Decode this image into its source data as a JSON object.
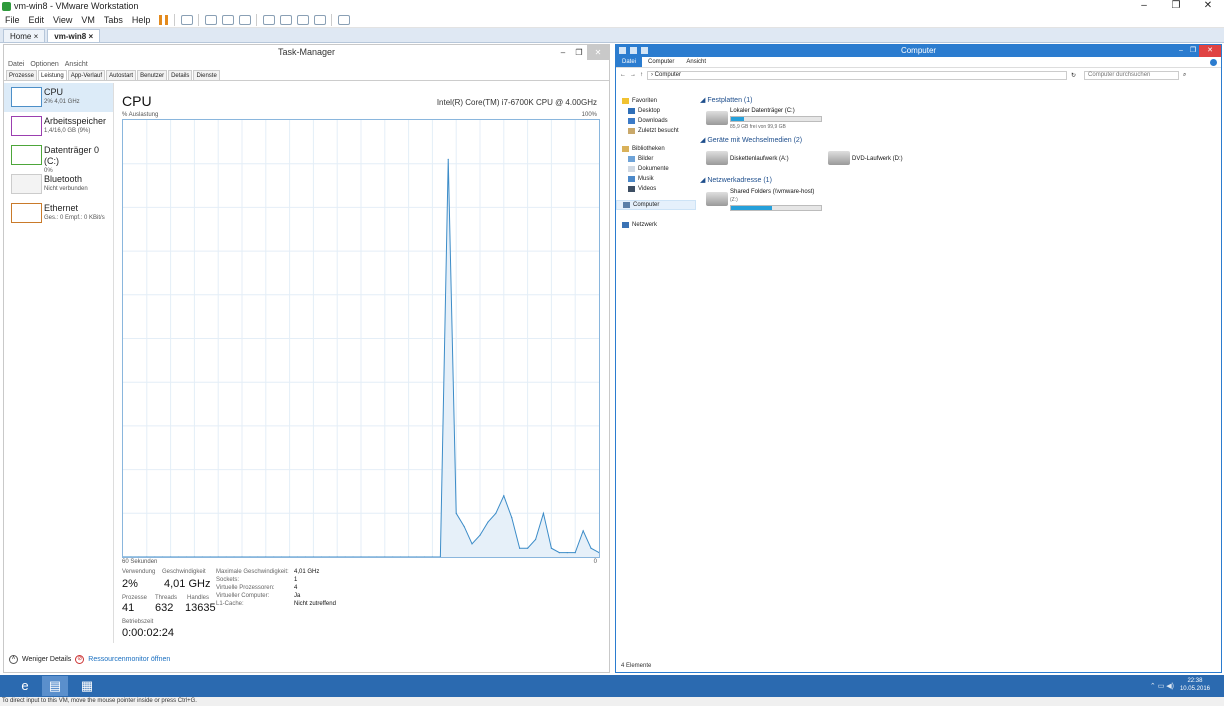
{
  "host": {
    "title": "vm-win8 - VMware Workstation",
    "window_controls": [
      "–",
      "❐",
      "✕"
    ],
    "menu": [
      "File",
      "Edit",
      "View",
      "VM",
      "Tabs",
      "Help"
    ],
    "tabs": [
      {
        "label": "Home"
      },
      {
        "label": "vm-win8"
      }
    ],
    "status": "To direct input to this VM, move the mouse pointer inside or press Ctrl+G."
  },
  "taskmgr": {
    "title": "Task-Manager",
    "menu": [
      "Datei",
      "Optionen",
      "Ansicht"
    ],
    "tabs": [
      "Prozesse",
      "Leistung",
      "App-Verlauf",
      "Autostart",
      "Benutzer",
      "Details",
      "Dienste"
    ],
    "sidebar": [
      {
        "name": "CPU",
        "value": "2% 4,01 GHz"
      },
      {
        "name": "Arbeitsspeicher",
        "value": "1,4/16,0 GB (9%)"
      },
      {
        "name": "Datenträger 0 (C:)",
        "value": "0%"
      },
      {
        "name": "Bluetooth",
        "value": "Nicht verbunden"
      },
      {
        "name": "Ethernet",
        "value": "Ges.: 0 Empf.: 0 KBit/s"
      }
    ],
    "heading": "CPU",
    "cpu_model": "Intel(R) Core(TM) i7-6700K CPU @ 4.00GHz",
    "util_label": "% Auslastung",
    "max_label": "100%",
    "time_label": "60 Sekunden",
    "zero_label": "0",
    "stats": {
      "usage_label": "Verwendung",
      "usage": "2%",
      "speed_label": "Geschwindigkeit",
      "speed": "4,01 GHz",
      "proc_label": "Prozesse",
      "proc": "41",
      "threads_label": "Threads",
      "threads": "632",
      "handles_label": "Handles",
      "handles": "13635",
      "uptime_label": "Betriebszeit",
      "uptime": "0:00:02:24"
    },
    "details": [
      {
        "k": "Maximale Geschwindigkeit:",
        "v": "4,01 GHz"
      },
      {
        "k": "Sockets:",
        "v": "1"
      },
      {
        "k": "Virtuelle Prozessoren:",
        "v": "4"
      },
      {
        "k": "Virtueller Computer:",
        "v": "Ja"
      },
      {
        "k": "L1-Cache:",
        "v": "Nicht zutreffend"
      }
    ],
    "footer": {
      "less": "Weniger Details",
      "resmon": "Ressourcenmonitor öffnen"
    }
  },
  "chart_data": {
    "type": "area",
    "title": "CPU",
    "xlabel": "60 Sekunden",
    "ylabel": "% Auslastung",
    "xlim": [
      60,
      0
    ],
    "ylim": [
      0,
      100
    ],
    "x": [
      60,
      59,
      58,
      57,
      56,
      55,
      54,
      53,
      52,
      51,
      50,
      49,
      48,
      47,
      46,
      45,
      44,
      43,
      42,
      41,
      40,
      39,
      38,
      37,
      36,
      35,
      34,
      33,
      32,
      31,
      30,
      29,
      28,
      27,
      26,
      25,
      24,
      23,
      22,
      21,
      20,
      19,
      18,
      17,
      16,
      15,
      14,
      13,
      12,
      11,
      10,
      9,
      8,
      7,
      6,
      5,
      4,
      3,
      2,
      1,
      0
    ],
    "values": [
      0,
      0,
      0,
      0,
      0,
      0,
      0,
      0,
      0,
      0,
      0,
      0,
      0,
      0,
      0,
      0,
      0,
      0,
      0,
      0,
      0,
      0,
      0,
      0,
      0,
      0,
      0,
      0,
      0,
      0,
      0,
      0,
      0,
      0,
      0,
      0,
      0,
      0,
      0,
      0,
      0,
      91,
      10,
      7,
      3,
      5,
      8,
      10,
      14,
      9,
      2,
      2,
      4,
      10,
      2,
      1,
      1,
      1,
      6,
      2,
      1
    ]
  },
  "explorer": {
    "title": "Computer",
    "ribbon": [
      "Datei",
      "Computer",
      "Ansicht"
    ],
    "address": "› Computer",
    "search_placeholder": "Computer durchsuchen",
    "nav": [
      {
        "label": "Favoriten",
        "level": "top"
      },
      {
        "label": "Desktop",
        "level": "sub"
      },
      {
        "label": "Downloads",
        "level": "sub"
      },
      {
        "label": "Zuletzt besucht",
        "level": "sub"
      },
      {
        "label": "Bibliotheken",
        "level": "top"
      },
      {
        "label": "Bilder",
        "level": "sub"
      },
      {
        "label": "Dokumente",
        "level": "sub"
      },
      {
        "label": "Musik",
        "level": "sub"
      },
      {
        "label": "Videos",
        "level": "sub"
      },
      {
        "label": "Computer",
        "level": "top"
      },
      {
        "label": "Netzwerk",
        "level": "top"
      }
    ],
    "groups": {
      "disks": "Festplatten (1)",
      "removable": "Geräte mit Wechselmedien (2)",
      "network": "Netzwerkadresse (1)"
    },
    "drives": {
      "c_name": "Lokaler Datenträger (C:)",
      "c_free": "85,9 GB frei von 99,9 GB",
      "c_used": 0.14,
      "a_name": "Diskettenlaufwerk (A:)",
      "d_name": "DVD-Laufwerk (D:)",
      "z_name": "Shared Folders (\\\\vmware-host)",
      "z_sub": "(Z:)",
      "z_used": 0.45
    },
    "status": "4 Elemente"
  },
  "guest": {
    "clock_time": "22:38",
    "clock_date": "10.05.2016"
  }
}
